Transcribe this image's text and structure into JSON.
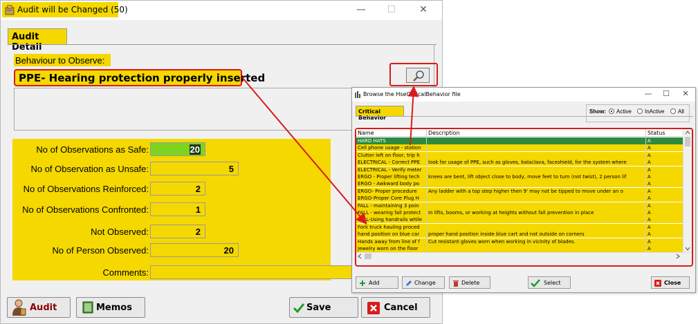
{
  "main_window": {
    "title": "Audit will be Changed  (50)",
    "controls": {
      "minimize": "—",
      "maximize": "☐",
      "close": "✕"
    },
    "tab": "Audit Detail",
    "behaviour_label": "Behaviour to Observe:",
    "behaviour_value": "PPE- Hearing protection properly inserted",
    "stats": [
      {
        "label": "No of Observations as Safe:",
        "value": "20"
      },
      {
        "label": "No of Observation as Unsafe:",
        "value": "5"
      },
      {
        "label": "No of Observations Reinforced:",
        "value": "2"
      },
      {
        "label": "No of Observations Confronted:",
        "value": "1"
      },
      {
        "label": "Not Observed:",
        "value": "2"
      },
      {
        "label": "No of Person Observed:",
        "value": "20"
      },
      {
        "label": "Comments:",
        "value": ""
      }
    ],
    "buttons": {
      "audit": "Audit",
      "memos": "Memos",
      "save": "Save",
      "cancel": "Cancel"
    }
  },
  "browse_window": {
    "title": "Browse the HseCriticalBehavior file",
    "controls": {
      "minimize": "—",
      "maximize": "☐",
      "close": "✕"
    },
    "tab": "Critical Behavior",
    "show": {
      "label": "Show:",
      "options": [
        "Active",
        "InActive",
        "All"
      ],
      "selected": "Active"
    },
    "columns": [
      "Name",
      "Description",
      "Status"
    ],
    "rows": [
      {
        "name": "HARD HATS",
        "description": "",
        "status": "A"
      },
      {
        "name": "Cell phone usage - station",
        "description": "",
        "status": "A"
      },
      {
        "name": "Clutter left on floor, trip h",
        "description": "",
        "status": "A"
      },
      {
        "name": "ELECTRICAL - Correct PPE",
        "description": "look for usage of PPE, such as gloves, balaclava, faceshield, for the system where",
        "status": "A"
      },
      {
        "name": "ELECTRICAL - Verify meter",
        "description": "",
        "status": "A"
      },
      {
        "name": "ERGO - Proper lifting tech",
        "description": "knees are bent, lift object close to body, move feet to turn (not twist), 2 person lif",
        "status": "A"
      },
      {
        "name": "ERGO - Awkward body po",
        "description": "",
        "status": "A"
      },
      {
        "name": "ERGO- Proper procedure",
        "description": "Any ladder with a top step higher then 9' may not be tipped to move under an o",
        "status": "A"
      },
      {
        "name": "ERGO-Proper Core Plug H",
        "description": "",
        "status": "A"
      },
      {
        "name": "FALL - maintaining 3 poin",
        "description": "",
        "status": "A"
      },
      {
        "name": "FALL - wearing fall protect",
        "description": "In lifts, booms, or working at heights without fall prevention in place",
        "status": "A"
      },
      {
        "name": "FALL-Using handrails while",
        "description": "",
        "status": "A"
      },
      {
        "name": "Fork truck hauling proced",
        "description": "",
        "status": "A"
      },
      {
        "name": "hand position on blue car",
        "description": "proper hand position inside blue cart and not outside on corners",
        "status": "A"
      },
      {
        "name": "Hands away from line of f",
        "description": "Cut resistant gloves worn when working in vicinity of blades.",
        "status": "A"
      },
      {
        "name": "Jewelry worn on the floor",
        "description": "",
        "status": "A"
      }
    ],
    "buttons": {
      "add": "Add",
      "change": "Change",
      "delete": "Delete",
      "select": "Select",
      "close": "Close"
    }
  },
  "colors": {
    "highlight": "#f5d800",
    "annotation": "#d81b1b",
    "selected_row": "#2d8a3e",
    "safe_field": "#7ed321"
  }
}
